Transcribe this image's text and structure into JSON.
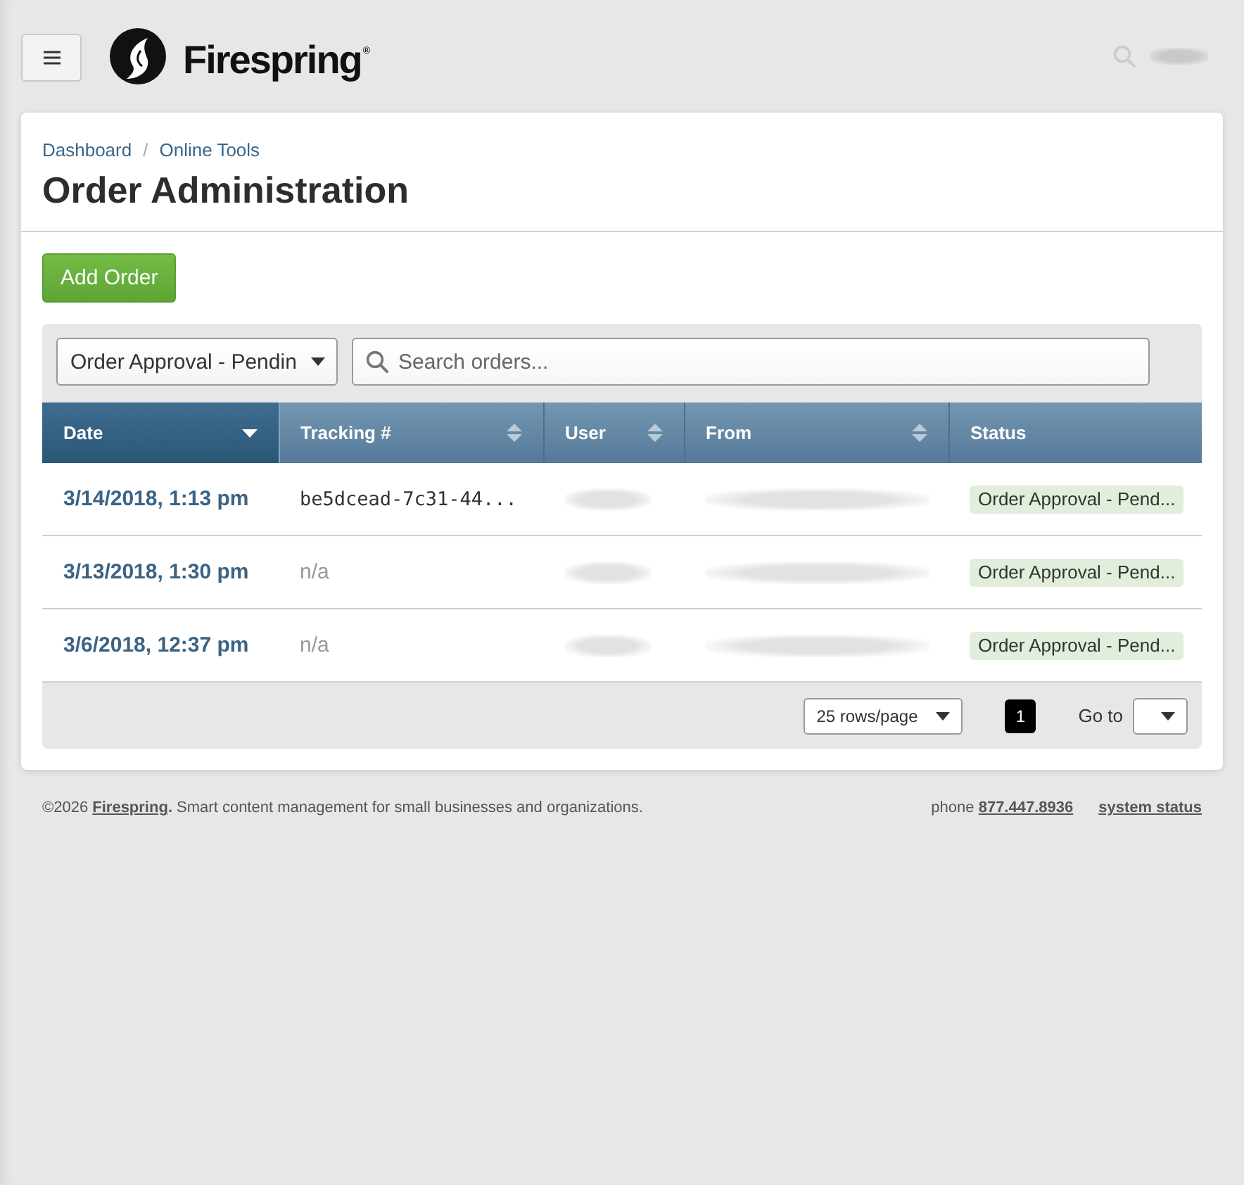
{
  "header": {
    "brand": "Firespring$^{®}$"
  },
  "breadcrumb": {
    "items": [
      {
        "label": "Dashboard"
      },
      {
        "label": "Online Tools"
      }
    ],
    "separator": "/"
  },
  "page_title": "Order Administration",
  "add_button": {
    "label": "Add Order"
  },
  "filter": {
    "value": "Order Approval - Pendin"
  },
  "search": {
    "placeholder": "Search orders..."
  },
  "table": {
    "columns": [
      {
        "label": "Date",
        "sortable": true,
        "selected": true
      },
      {
        "label": "Tracking #",
        "sortable": true,
        "selected": false
      },
      {
        "label": "User",
        "sortable": true,
        "selected": false
      },
      {
        "label": "From",
        "sortable": true,
        "selected": false
      },
      {
        "label": "Status",
        "sortable": false,
        "selected": false
      }
    ],
    "rows": [
      {
        "cells": [
          {
            "kind": "link",
            "text": "3/14/2018, 1:13 pm"
          },
          {
            "kind": "code",
            "text": "be5dcead-7c31-44..."
          },
          {
            "kind": "redacted"
          },
          {
            "kind": "redacted"
          },
          {
            "kind": "badge",
            "text": "Order Approval - Pend..."
          }
        ]
      },
      {
        "cells": [
          {
            "kind": "link",
            "text": "3/13/2018, 1:30 pm"
          },
          {
            "kind": "muted",
            "text": "n/a"
          },
          {
            "kind": "redacted"
          },
          {
            "kind": "redacted"
          },
          {
            "kind": "badge",
            "text": "Order Approval - Pend..."
          }
        ]
      },
      {
        "cells": [
          {
            "kind": "link",
            "text": "3/6/2018, 12:37 pm"
          },
          {
            "kind": "muted",
            "text": "n/a"
          },
          {
            "kind": "redacted"
          },
          {
            "kind": "redacted"
          },
          {
            "kind": "badge",
            "text": "Order Approval - Pend..."
          }
        ]
      }
    ]
  },
  "pagination": {
    "rows_per_page": "25 rows/page",
    "pages": [
      {
        "label": "1",
        "selected": true
      }
    ],
    "goto_label": "Go to"
  },
  "footer": {
    "copyright": "©2026",
    "company_link": "Firespring",
    "tagline": "**.** Smart content management for small businesses and organizations.",
    "phone_label": "phone",
    "phone_number": "877.447.8936",
    "status_link": "system status"
  }
}
